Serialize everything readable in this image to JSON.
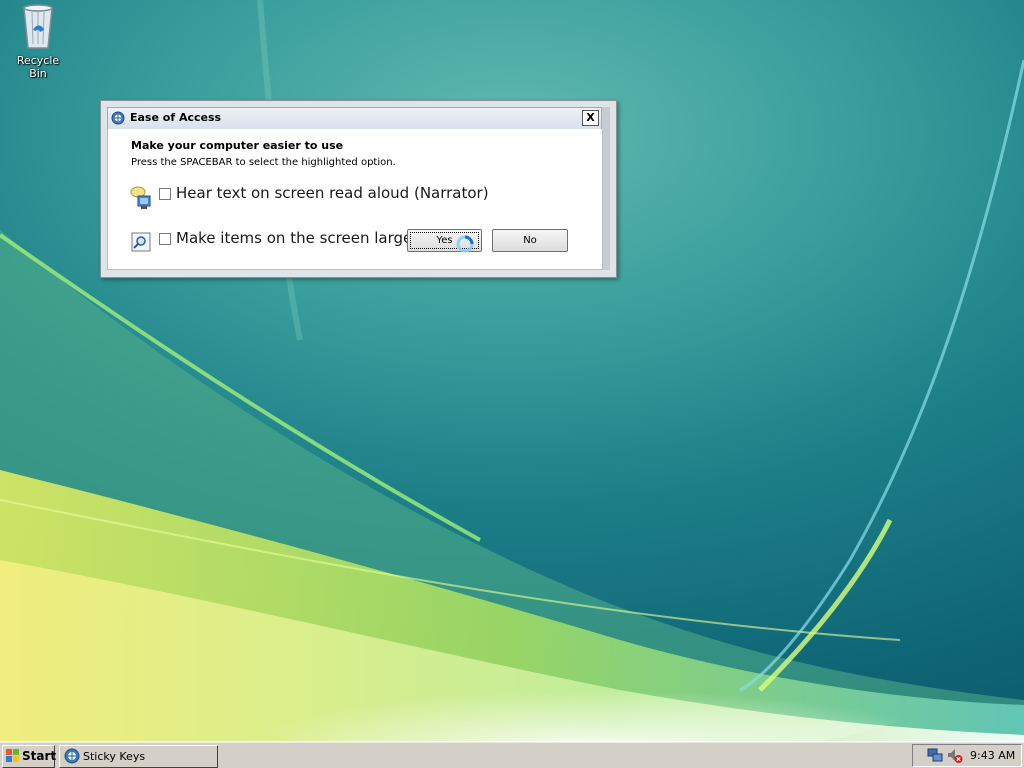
{
  "desktop": {
    "icons": [
      {
        "label": "Recycle Bin",
        "icon": "recycle-bin-icon"
      }
    ]
  },
  "dialog": {
    "title": "Ease of Access",
    "close_label": "X",
    "heading": "Make your computer easier to use",
    "instruction": "Press the SPACEBAR to select the highlighted option.",
    "options": [
      {
        "label": "Hear text on screen read aloud (Narrator)",
        "checked": false,
        "icon": "narrator-icon"
      },
      {
        "label": "Make items on the screen larger (",
        "checked": false,
        "icon": "magnifier-icon"
      }
    ],
    "buttons": {
      "yes": "Yes",
      "no": "No"
    }
  },
  "taskbar": {
    "start_label": "Start",
    "tasks": [
      {
        "label": "Sticky Keys",
        "icon": "ease-of-access-icon"
      }
    ],
    "tray": {
      "icons": [
        "network-icon",
        "volume-muted-icon"
      ],
      "clock": "9:43 AM"
    }
  }
}
